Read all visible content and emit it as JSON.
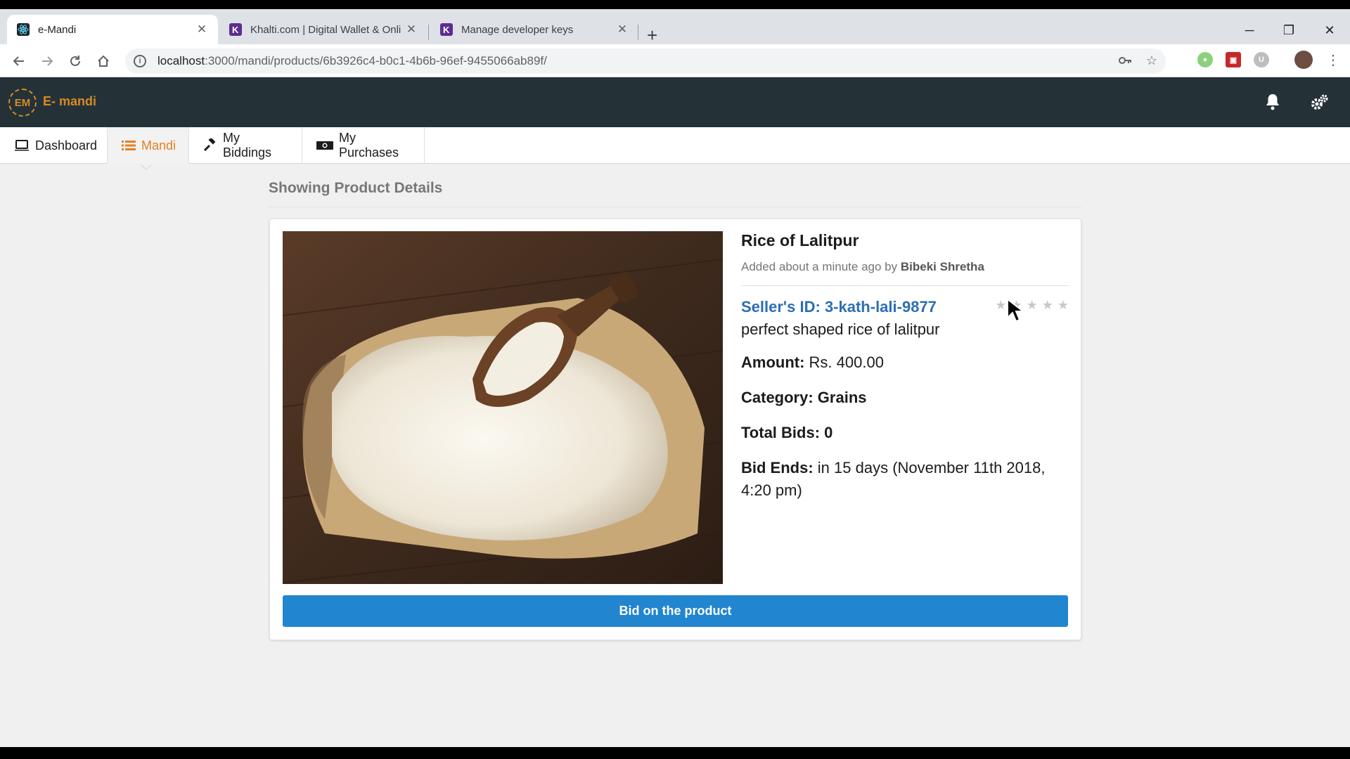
{
  "browser": {
    "tabs": [
      {
        "title": "e-Mandi",
        "favicon": "react-icon",
        "active": true
      },
      {
        "title": "Khalti.com | Digital Wallet & Onli",
        "favicon": "khalti-icon",
        "active": false
      },
      {
        "title": "Manage developer keys",
        "favicon": "khalti-icon",
        "active": false
      }
    ],
    "url_host": "localhost",
    "url_path": ":3000/mandi/products/6b3926c4-b0c1-4b6b-96ef-9455066ab89f/"
  },
  "app": {
    "logo_text": "EM",
    "brand": "E- mandi",
    "accent_color": "#d68a25",
    "nav": [
      {
        "label": "Dashboard",
        "icon": "laptop-icon"
      },
      {
        "label": "Mandi",
        "icon": "list-icon",
        "active": true
      },
      {
        "label": "My Biddings",
        "icon": "gavel-icon"
      },
      {
        "label": "My Purchases",
        "icon": "money-icon"
      }
    ]
  },
  "page": {
    "header": "Showing Product Details"
  },
  "product": {
    "title": "Rice of Lalitpur",
    "added_prefix": "Added about a minute ago by",
    "seller_name": "Bibeki Shretha",
    "seller_id": "Seller's ID: 3-kath-lali-9877",
    "rating": 0,
    "rating_max": 5,
    "description": "perfect shaped rice of lalitpur",
    "amount_label": "Amount:",
    "amount_value": "Rs. 400.00",
    "category": "Category: Grains",
    "total_bids": "Total Bids: 0",
    "bid_ends_label": "Bid Ends:",
    "bid_ends_value": "in 15 days (November 11th 2018, 4:20 pm)",
    "bid_button": "Bid on the product",
    "button_color": "#2185d0"
  }
}
